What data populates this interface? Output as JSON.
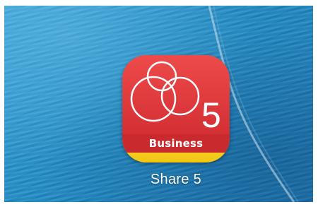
{
  "app": {
    "name": "Share 5",
    "icon_label": "Business",
    "icon_number": "5",
    "icon": "share5-business-app-icon"
  },
  "colors": {
    "icon_red": "#e03c40",
    "icon_band": "#c82a2e",
    "icon_yellow": "#f5d22a",
    "wallpaper_blue": "#1e8dc4"
  }
}
